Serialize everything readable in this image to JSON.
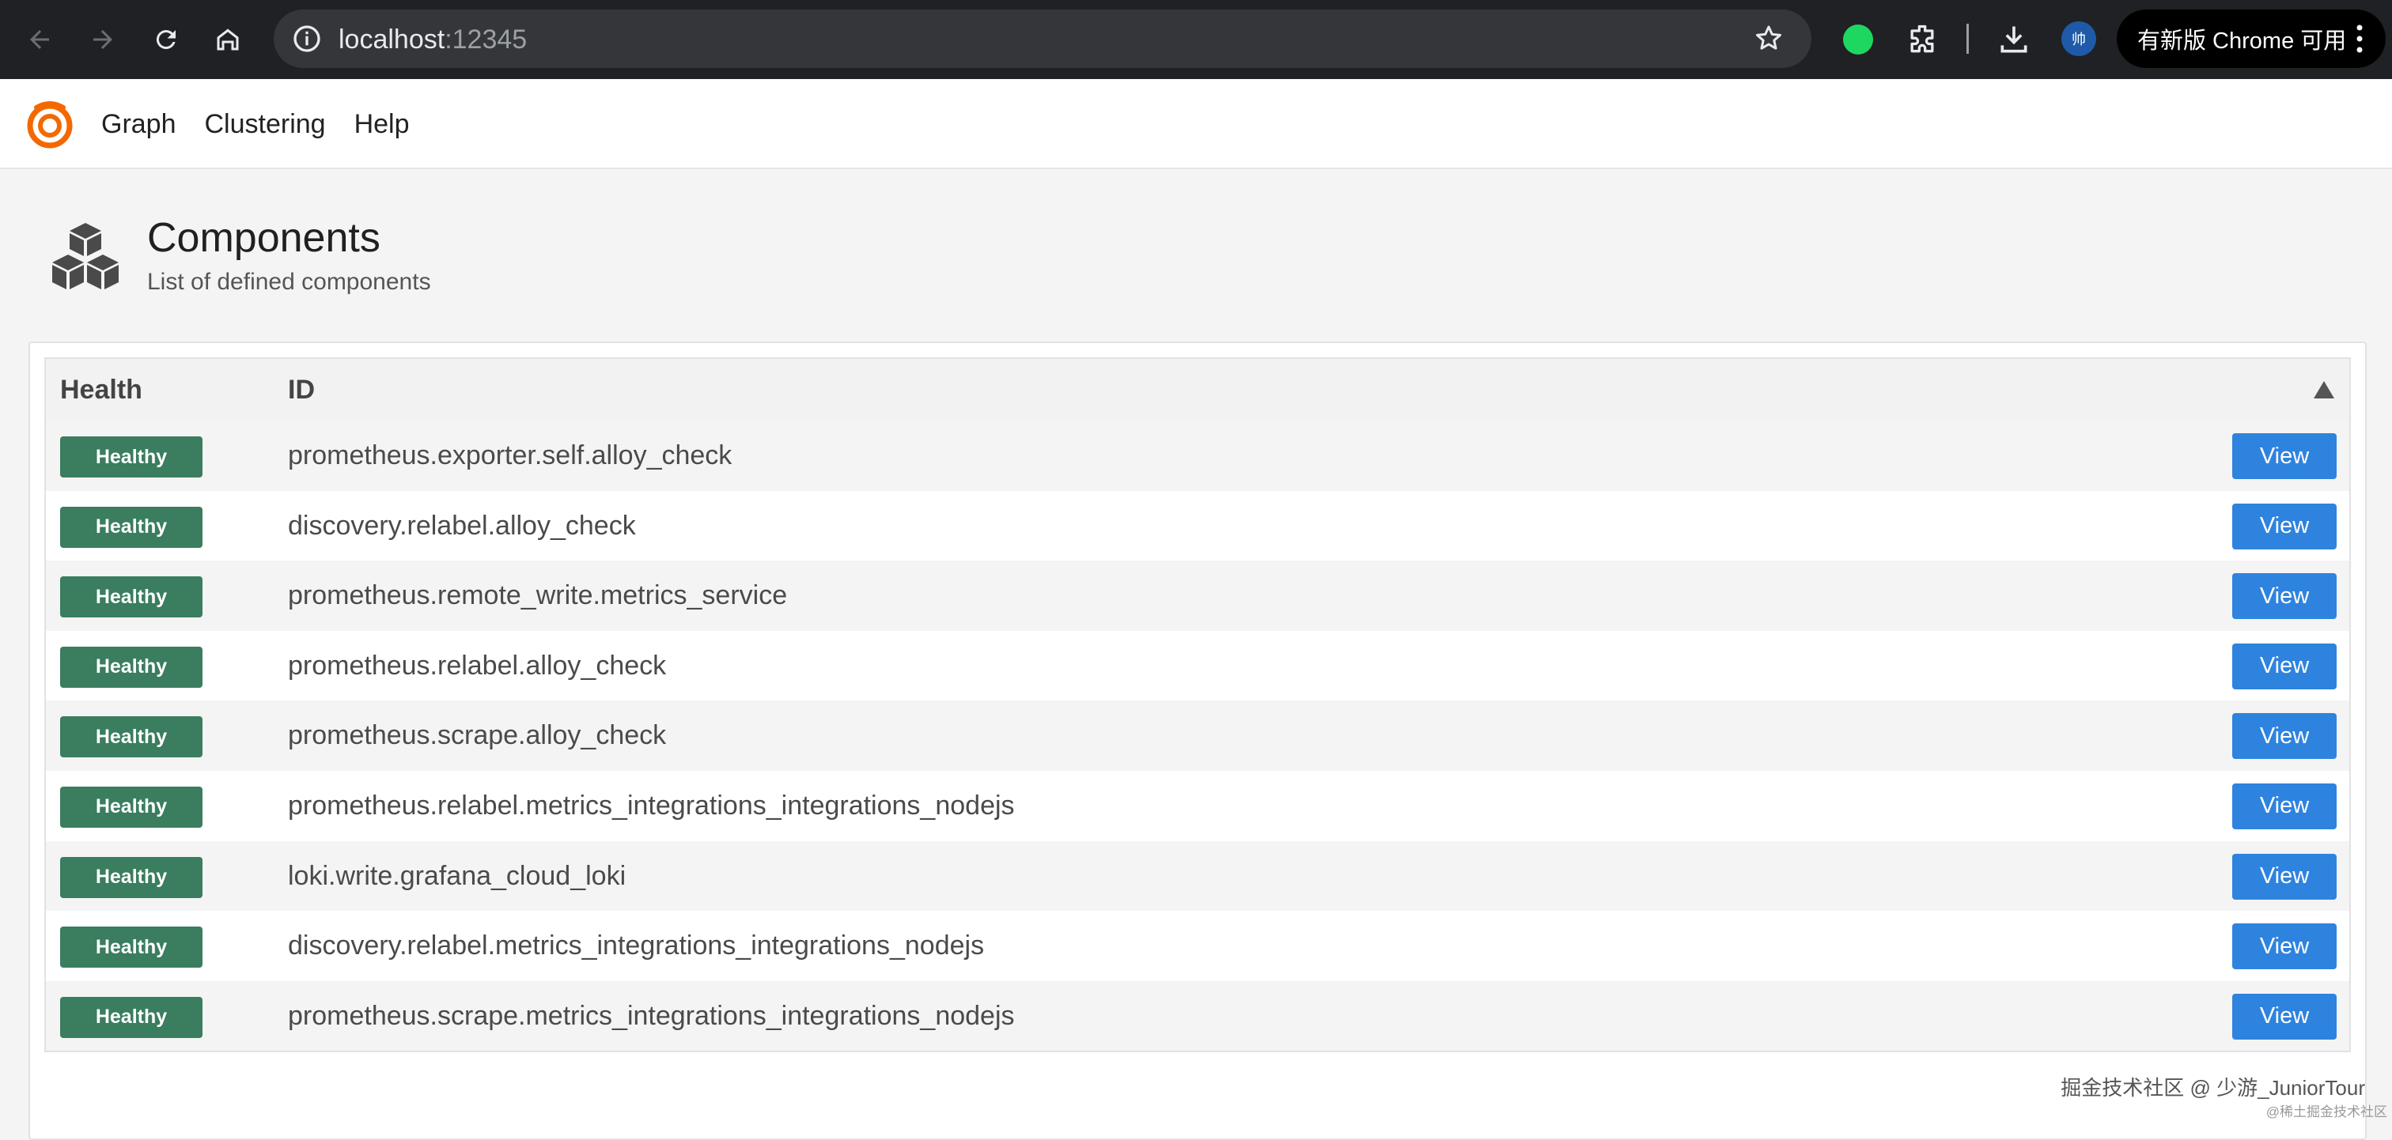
{
  "browser": {
    "url_host": "localhost",
    "url_port": ":12345",
    "profile_initial": "帅",
    "update_label": "有新版 Chrome 可用"
  },
  "app": {
    "nav": [
      {
        "label": "Graph"
      },
      {
        "label": "Clustering"
      },
      {
        "label": "Help"
      }
    ]
  },
  "page": {
    "title": "Components",
    "subtitle": "List of defined components"
  },
  "table": {
    "columns": {
      "health": "Health",
      "id": "ID"
    },
    "sort_direction": "ascending",
    "view_label": "View",
    "rows": [
      {
        "health": "Healthy",
        "id": "prometheus.exporter.self.alloy_check"
      },
      {
        "health": "Healthy",
        "id": "discovery.relabel.alloy_check"
      },
      {
        "health": "Healthy",
        "id": "prometheus.remote_write.metrics_service"
      },
      {
        "health": "Healthy",
        "id": "prometheus.relabel.alloy_check"
      },
      {
        "health": "Healthy",
        "id": "prometheus.scrape.alloy_check"
      },
      {
        "health": "Healthy",
        "id": "prometheus.relabel.metrics_integrations_integrations_nodejs"
      },
      {
        "health": "Healthy",
        "id": "loki.write.grafana_cloud_loki"
      },
      {
        "health": "Healthy",
        "id": "discovery.relabel.metrics_integrations_integrations_nodejs"
      },
      {
        "health": "Healthy",
        "id": "prometheus.scrape.metrics_integrations_integrations_nodejs"
      }
    ]
  },
  "watermark": {
    "line1": "掘金技术社区 @ 少游_JuniorTour",
    "line2": "@稀土掘金技术社区"
  },
  "colors": {
    "healthy": "#3a7d5f",
    "view_button": "#2e83de",
    "logo": "#f46800"
  }
}
